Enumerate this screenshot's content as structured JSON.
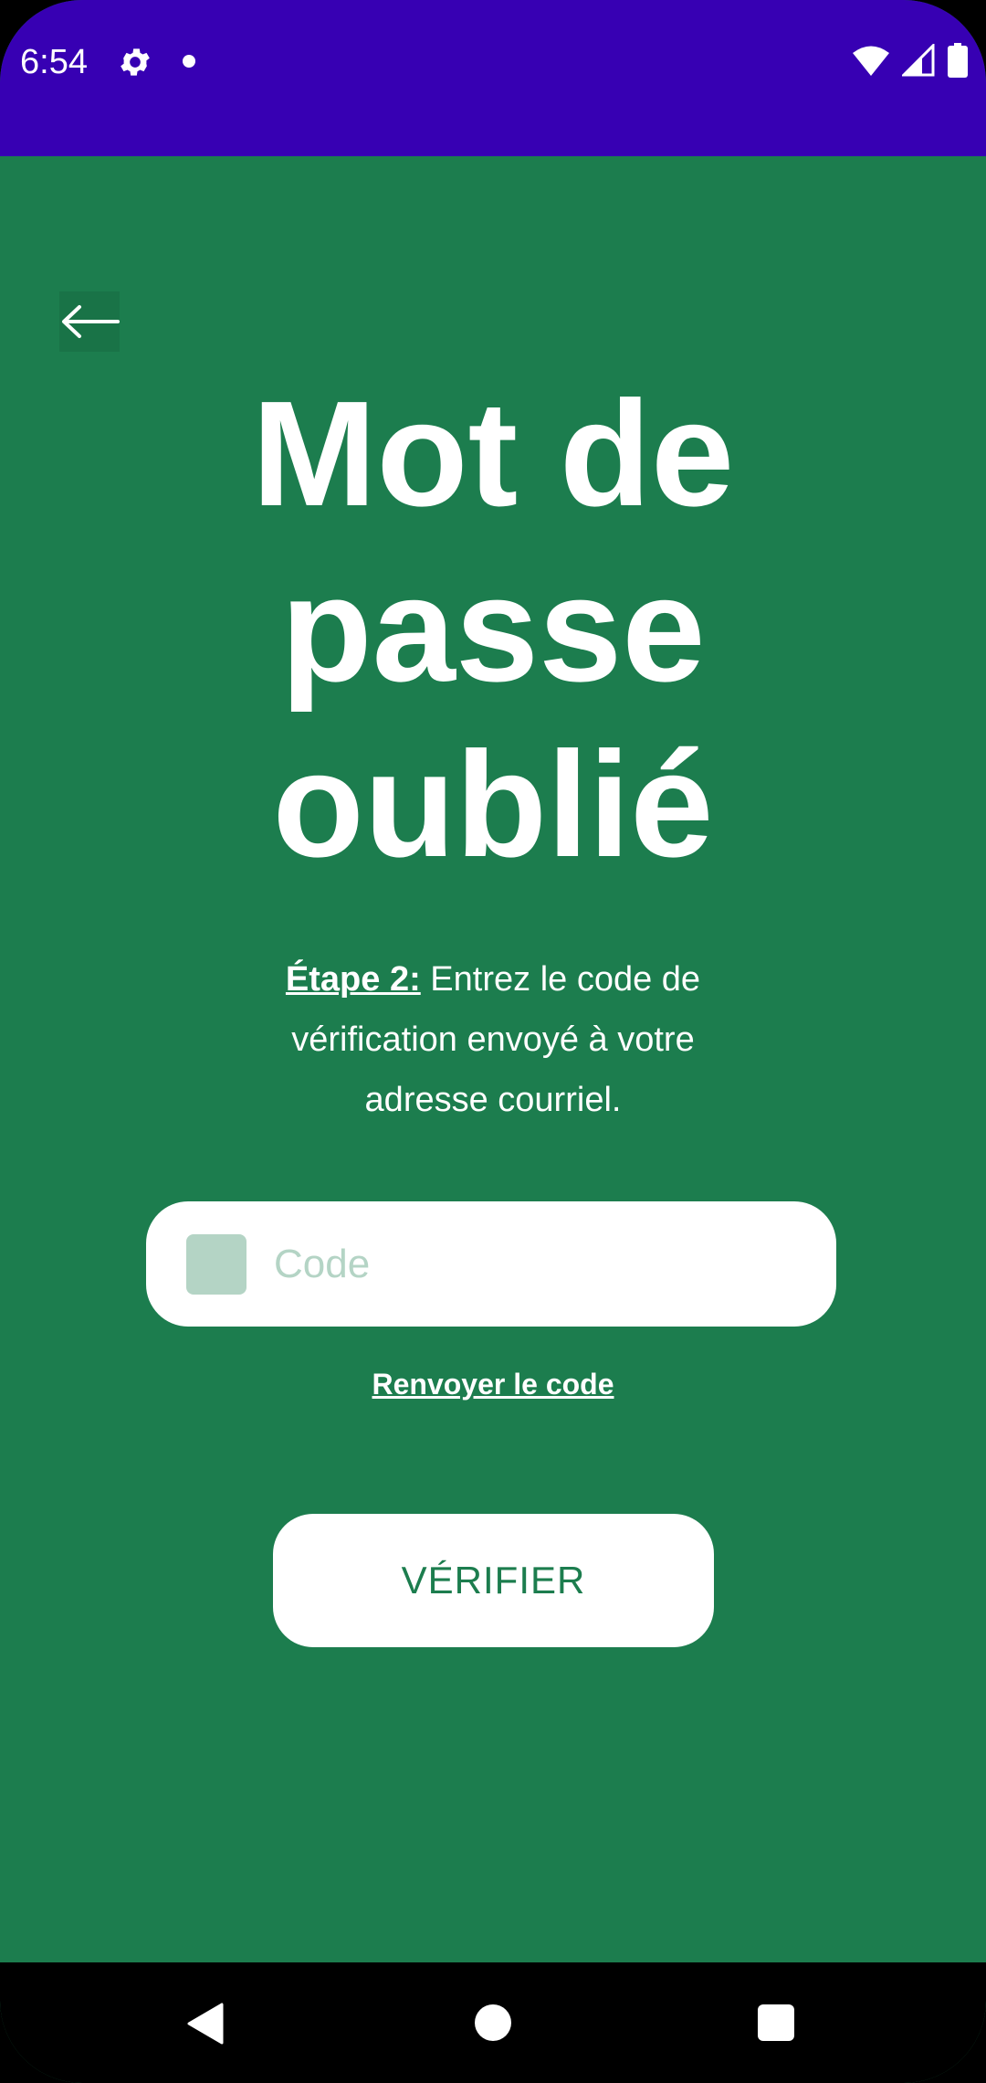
{
  "status_bar": {
    "time": "6:54",
    "icons": [
      "gear-icon",
      "notification-dot-icon",
      "wifi-icon",
      "signal-icon",
      "battery-icon"
    ]
  },
  "header": {
    "back_icon": "arrow-left-icon"
  },
  "title": {
    "line1": "Mot de",
    "line2": "passe",
    "line3": "oublié"
  },
  "instructions": {
    "step_label": "Étape 2:",
    "text": " Entrez le code de vérification envoyé à votre adresse courriel."
  },
  "code_field": {
    "placeholder": "Code",
    "value": "",
    "icon": "key-icon"
  },
  "resend_link": "Renvoyer le code",
  "verify_button": "VÉRIFIER",
  "nav_bar": {
    "icons": [
      "nav-back-icon",
      "nav-home-icon",
      "nav-recents-icon"
    ]
  },
  "colors": {
    "status_bar_bg": "#3700b3",
    "page_bg": "#1c7d4e",
    "field_icon": "#b4d4c5",
    "button_text": "#1c7d4e"
  }
}
